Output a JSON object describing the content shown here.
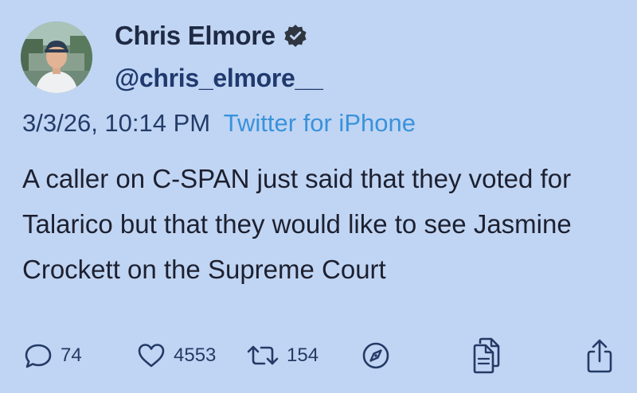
{
  "user": {
    "display_name": "Chris Elmore",
    "handle": "@chris_elmore__",
    "verified": true,
    "avatar": "profile-photo"
  },
  "tweet": {
    "date": "3/3/26, 10:14 PM",
    "source": "Twitter for iPhone",
    "text": "A caller on C-SPAN just said that they voted for Talarico but that they would like to see Jasmine Crockett on the Supreme Court"
  },
  "actions": {
    "replies": "74",
    "likes": "4553",
    "retweets": "154",
    "icons": [
      "reply-icon",
      "like-icon",
      "retweet-icon",
      "explore-icon",
      "copy-icon",
      "share-icon"
    ]
  },
  "colors": {
    "background": "#c0d5f3",
    "link": "#3a92db",
    "accent": "#243a66"
  }
}
